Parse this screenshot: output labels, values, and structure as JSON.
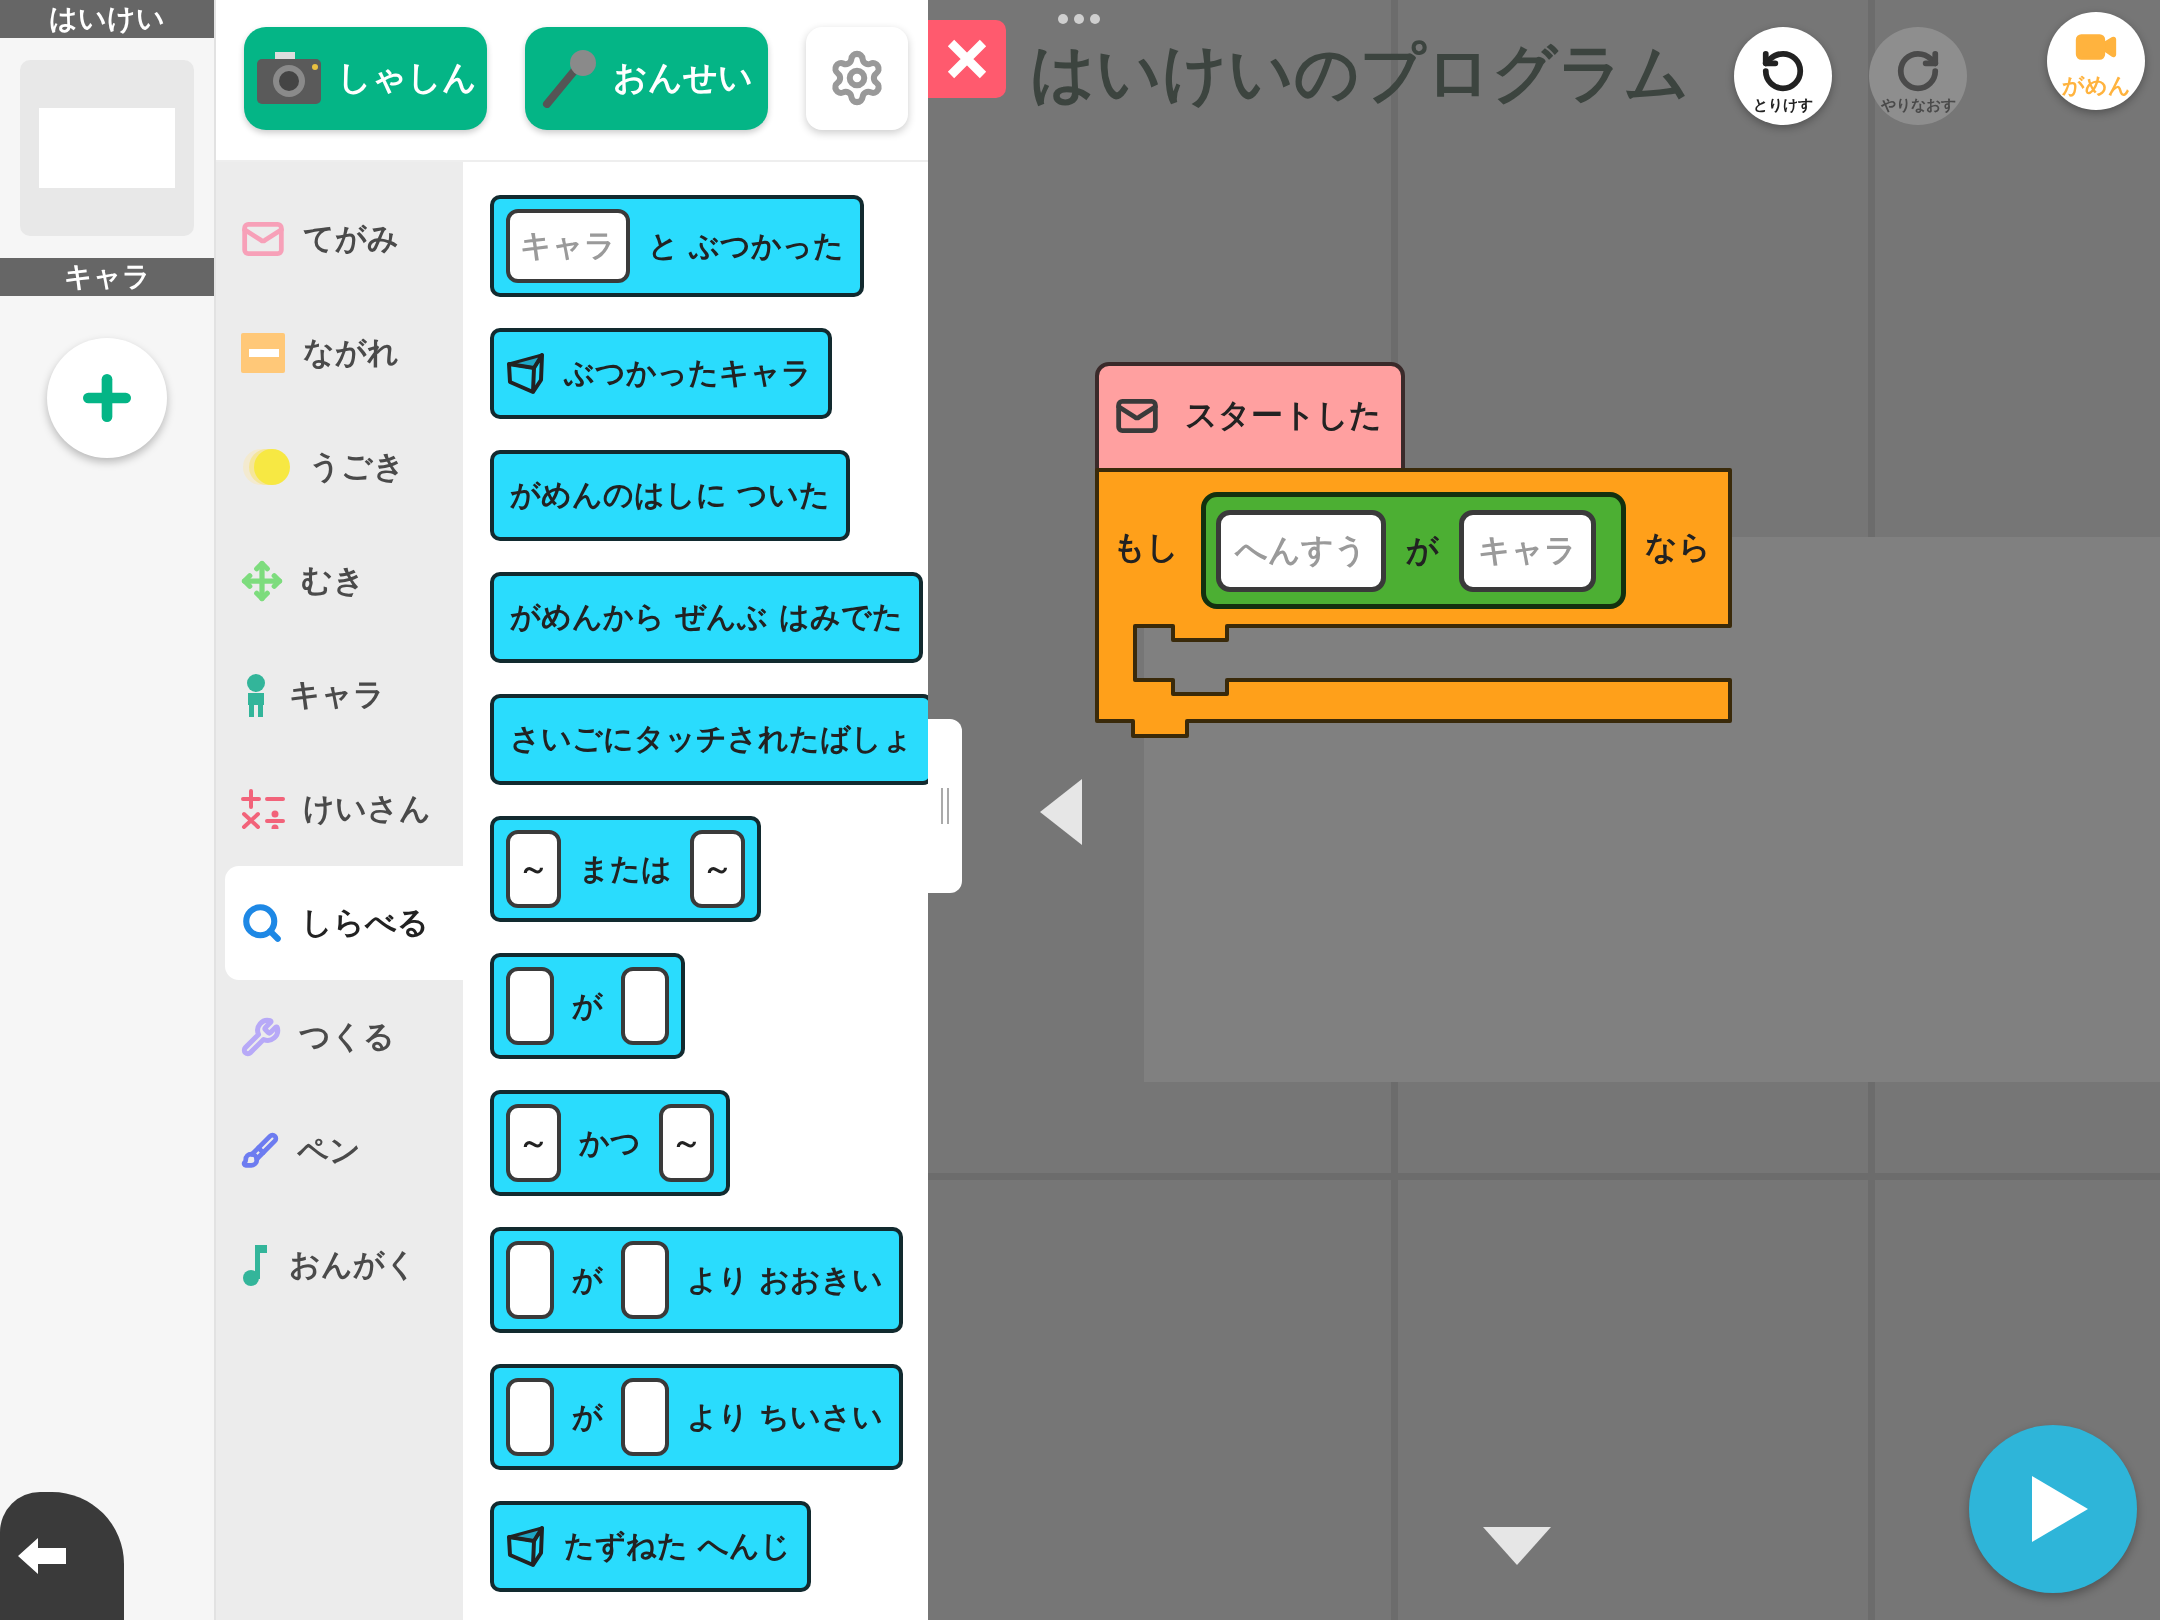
{
  "sidebar": {
    "background_header": "はいけい",
    "character_header": "キャラ"
  },
  "media_buttons": [
    {
      "label": "しゃしん"
    },
    {
      "label": "おんせい"
    }
  ],
  "categories": [
    {
      "label": "てがみ",
      "selected": false
    },
    {
      "label": "ながれ",
      "selected": false
    },
    {
      "label": "うごき",
      "selected": false
    },
    {
      "label": "むき",
      "selected": false
    },
    {
      "label": "キャラ",
      "selected": false
    },
    {
      "label": "けいさん",
      "selected": false
    },
    {
      "label": "しらべる",
      "selected": true
    },
    {
      "label": "つくる",
      "selected": false
    },
    {
      "label": "ペン",
      "selected": false
    },
    {
      "label": "おんがく",
      "selected": false
    }
  ],
  "blocks": [
    {
      "parts": [
        {
          "kind": "slot",
          "placeholder": "キャラ"
        },
        {
          "kind": "text",
          "text": "と ぶつかった"
        }
      ]
    },
    {
      "parts": [
        {
          "kind": "icon"
        },
        {
          "kind": "text",
          "text": "ぶつかったキャラ"
        }
      ]
    },
    {
      "parts": [
        {
          "kind": "text",
          "text": "がめんのはしに ついた"
        }
      ]
    },
    {
      "parts": [
        {
          "kind": "text",
          "text": "がめんから ぜんぶ はみでた"
        }
      ]
    },
    {
      "parts": [
        {
          "kind": "text",
          "text": "さいごにタッチされたばしょ"
        }
      ]
    },
    {
      "parts": [
        {
          "kind": "slot",
          "text": "～"
        },
        {
          "kind": "text",
          "text": "または"
        },
        {
          "kind": "slot",
          "text": "～"
        }
      ]
    },
    {
      "parts": [
        {
          "kind": "slot"
        },
        {
          "kind": "text",
          "text": "が"
        },
        {
          "kind": "slot"
        }
      ]
    },
    {
      "parts": [
        {
          "kind": "slot",
          "text": "～"
        },
        {
          "kind": "text",
          "text": "かつ"
        },
        {
          "kind": "slot",
          "text": "～"
        }
      ]
    },
    {
      "parts": [
        {
          "kind": "slot"
        },
        {
          "kind": "text",
          "text": "が"
        },
        {
          "kind": "slot"
        },
        {
          "kind": "text",
          "text": "より おおきい"
        }
      ]
    },
    {
      "parts": [
        {
          "kind": "slot"
        },
        {
          "kind": "text",
          "text": "が"
        },
        {
          "kind": "slot"
        },
        {
          "kind": "text",
          "text": "より ちいさい"
        }
      ]
    },
    {
      "parts": [
        {
          "kind": "icon"
        },
        {
          "kind": "text",
          "text": "たずねた へんじ"
        }
      ]
    }
  ],
  "canvas": {
    "title": "はいけいのプログラム",
    "undo": {
      "label": "とりけす",
      "disabled": false
    },
    "redo": {
      "label": "やりなおす",
      "disabled": true
    },
    "screen_button": {
      "label": "がめん"
    },
    "script": {
      "event_block": {
        "label": "スタートした"
      },
      "if_block": {
        "before": "もし",
        "condition": [
          {
            "kind": "slot",
            "placeholder": "へんすう"
          },
          {
            "kind": "text",
            "text": "が"
          },
          {
            "kind": "slot",
            "placeholder": "キャラ"
          }
        ],
        "after": "なら"
      }
    }
  }
}
